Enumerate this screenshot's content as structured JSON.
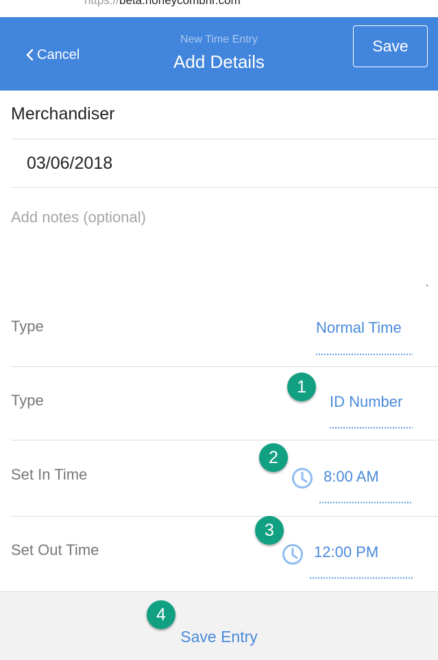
{
  "browser": {
    "url_prefix": "https://",
    "url_host": "beta.honeycombhr.com"
  },
  "header": {
    "cancel_label": "Cancel",
    "subtitle": "New Time Entry",
    "title": "Add Details",
    "save_label": "Save"
  },
  "form": {
    "position": "Merchandiser",
    "date": "03/06/2018",
    "notes_placeholder": "Add notes (optional)",
    "type_row_1": {
      "label": "Type",
      "value": "Normal Time"
    },
    "type_row_2": {
      "label": "Type",
      "value": "ID Number"
    },
    "in_time": {
      "label": "Set In Time",
      "value": "8:00 AM"
    },
    "out_time": {
      "label": "Set Out Time",
      "value": "12:00 PM"
    }
  },
  "badges": [
    "1",
    "2",
    "3",
    "4"
  ],
  "footer": {
    "save_entry_label": "Save Entry"
  },
  "colors": {
    "header_bg": "#4285dc",
    "accent": "#4a8ada",
    "badge": "#12a082"
  }
}
